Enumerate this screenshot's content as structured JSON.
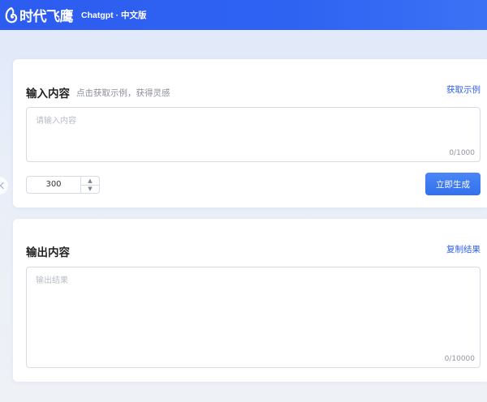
{
  "header": {
    "brand": "时代飞鹰",
    "app_name": "Chatgpt · 中文版"
  },
  "input_section": {
    "title": "输入内容",
    "hint": "点击获取示例，获得灵感",
    "example_link": "获取示例",
    "placeholder": "请输入内容",
    "counter": "0/1000",
    "stepper_value": "300",
    "generate_button": "立即生成"
  },
  "output_section": {
    "title": "输出内容",
    "copy_link": "复制结果",
    "placeholder": "输出结果",
    "counter": "0/10000"
  },
  "colors": {
    "header": "#2e60f1",
    "accent": "#2f5fe8",
    "button": "#3a78f0"
  },
  "icons": {
    "logo": "eagle-logo-icon",
    "side_toggle": "chevron-left-icon",
    "step_up": "caret-up-icon",
    "step_down": "caret-down-icon"
  }
}
